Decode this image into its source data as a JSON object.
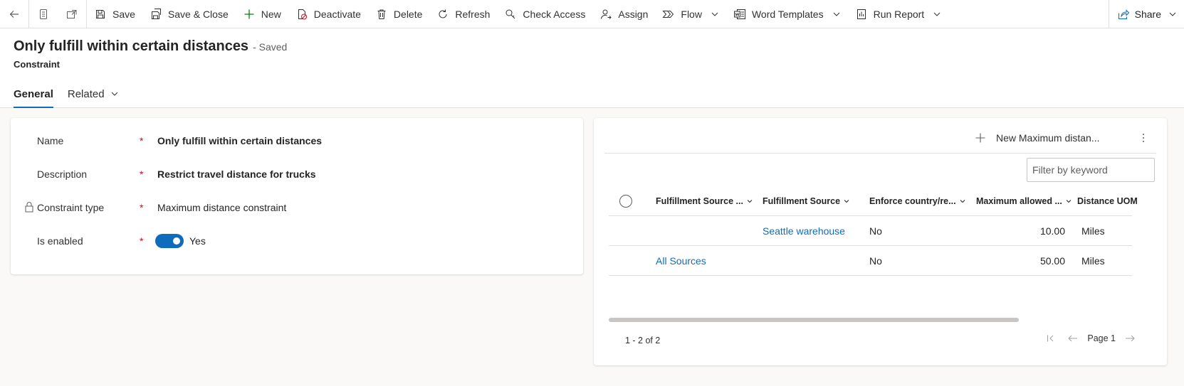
{
  "command_bar": {
    "back_icon": "back-arrow-icon",
    "record_icon": "record-icon",
    "popout_icon": "open-new-window-icon",
    "buttons": {
      "save": "Save",
      "save_close": "Save & Close",
      "new": "New",
      "deactivate": "Deactivate",
      "delete": "Delete",
      "refresh": "Refresh",
      "check_access": "Check Access",
      "assign": "Assign",
      "flow": "Flow",
      "word_templates": "Word Templates",
      "run_report": "Run Report",
      "share": "Share"
    }
  },
  "header": {
    "title": "Only fulfill within certain distances",
    "status": "- Saved",
    "entity": "Constraint",
    "tabs": [
      {
        "label": "General",
        "active": true
      },
      {
        "label": "Related",
        "active": false
      }
    ]
  },
  "form": {
    "fields": [
      {
        "label": "Name",
        "required": "*",
        "value": "Only fulfill within certain distances"
      },
      {
        "label": "Description",
        "required": "*",
        "value": "Restrict travel distance for trucks"
      },
      {
        "label": "Constraint type",
        "required": "*",
        "value": "Maximum distance constraint",
        "locked": true
      },
      {
        "label": "Is enabled",
        "required": "*",
        "value": "Yes",
        "toggle_on": true
      }
    ]
  },
  "subgrid": {
    "new_button": "New Maximum distan...",
    "filter_placeholder": "Filter by keyword",
    "columns": [
      "Fulfillment Source ...",
      "Fulfillment Source",
      "Enforce country/re...",
      "Maximum allowed ...",
      "Distance UOM"
    ],
    "rows": [
      {
        "source_group": "",
        "source": "Seattle warehouse",
        "enforce": "No",
        "max": "10.00",
        "uom": "Miles"
      },
      {
        "source_group": "All Sources",
        "source": "",
        "enforce": "No",
        "max": "50.00",
        "uom": "Miles"
      }
    ],
    "record_count": "1 - 2 of 2",
    "page_label": "Page 1"
  },
  "colors": {
    "accent": "#0f6cbd",
    "required": "#c50f1f",
    "background": "#faf9f8"
  }
}
